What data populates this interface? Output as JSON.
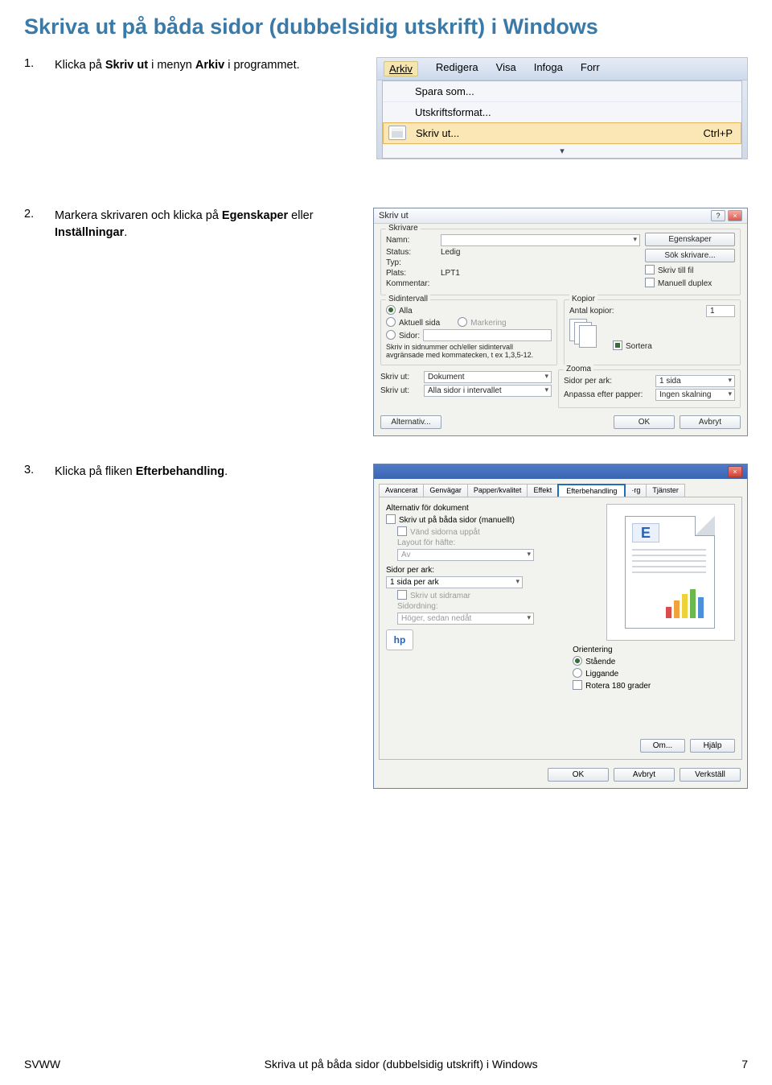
{
  "title": "Skriva ut på båda sidor (dubbelsidig utskrift) i Windows",
  "steps": {
    "s1": {
      "num": "1.",
      "text_a": "Klicka på ",
      "b1": "Skriv ut",
      "text_b": " i menyn ",
      "b2": "Arkiv",
      "text_c": " i programmet."
    },
    "s2": {
      "num": "2.",
      "text_a": "Markera skrivaren och klicka på ",
      "b1": "Egenskaper",
      "text_b": " eller ",
      "b2": "Inställningar",
      "text_c": "."
    },
    "s3": {
      "num": "3.",
      "text_a": "Klicka på fliken ",
      "b1": "Efterbehandling",
      "text_b": "."
    }
  },
  "fig1": {
    "menubar": {
      "arkiv": "Arkiv",
      "redigera": "Redigera",
      "visa": "Visa",
      "infoga": "Infoga",
      "forr": "Forr"
    },
    "items": {
      "spara_som": "Spara som...",
      "utskriftsformat": "Utskriftsformat...",
      "skriv_ut": "Skriv ut...",
      "shortcut": "Ctrl+P"
    },
    "expand": "▾"
  },
  "fig2": {
    "title": "Skriv ut",
    "help": "?",
    "close": "×",
    "grp_skrivare": "Skrivare",
    "lbl_namn": "Namn:",
    "lbl_status": "Status:",
    "val_status": "Ledig",
    "lbl_typ": "Typ:",
    "lbl_plats": "Plats:",
    "val_plats": "LPT1",
    "lbl_kommentar": "Kommentar:",
    "btn_egenskaper": "Egenskaper",
    "btn_sok": "Sök skrivare...",
    "cb_till_fil": "Skriv till fil",
    "cb_duplex": "Manuell duplex",
    "grp_sidintervall": "Sidintervall",
    "rb_alla": "Alla",
    "rb_aktuell": "Aktuell sida",
    "rb_markering": "Markering",
    "rb_sidor": "Sidor:",
    "sidor_hint": "Skriv in sidnummer och/eller sidintervall avgränsade med kommatecken, t ex 1,3,5-12.",
    "grp_kopior": "Kopior",
    "lbl_antal": "Antal kopior:",
    "val_antal": "1",
    "cb_sortera": "Sortera",
    "lbl_skriv_ut": "Skriv ut:",
    "val_skriv_ut": "Dokument",
    "lbl_skriv_ut2": "Skriv ut:",
    "val_skriv_ut2": "Alla sidor i intervallet",
    "grp_zooma": "Zooma",
    "lbl_sidor_per_ark": "Sidor per ark:",
    "val_sidor_per_ark": "1 sida",
    "lbl_anpassa": "Anpassa efter papper:",
    "val_anpassa": "Ingen skalning",
    "btn_alternativ": "Alternativ...",
    "btn_ok": "OK",
    "btn_avbryt": "Avbryt"
  },
  "fig3": {
    "title": " ",
    "close": "×",
    "tabs": {
      "avancerat": "Avancerat",
      "genvagar": "Genvägar",
      "papper": "Papper/kvalitet",
      "effekt": "Effekt",
      "efterbehandling": "Efterbehandling",
      "arg": "·rg",
      "tjanster": "Tjänster"
    },
    "grp_alt": "Alternativ för dokument",
    "cb_bada": "Skriv ut på båda sidor (manuellt)",
    "cb_vand": "Vänd sidorna uppåt",
    "lbl_layout": "Layout för häfte:",
    "val_layout": "Av",
    "lbl_sidor_ark": "Sidor per ark:",
    "val_sidor_ark": "1 sida per ark",
    "cb_ramar": "Skriv ut sidramar",
    "lbl_ordning": "Sidordning:",
    "val_ordning": "Höger, sedan nedåt",
    "preview_letter": "E",
    "grp_orient": "Orientering",
    "rb_staende": "Stående",
    "rb_liggande": "Liggande",
    "cb_rotera": "Rotera 180 grader",
    "btn_om": "Om...",
    "btn_hjalp": "Hjälp",
    "btn_ok": "OK",
    "btn_avbryt": "Avbryt",
    "btn_verkstall": "Verkställ",
    "logo": "hp"
  },
  "footer": {
    "left": "SVWW",
    "mid": "Skriva ut på båda sidor (dubbelsidig utskrift) i Windows",
    "right": "7"
  }
}
